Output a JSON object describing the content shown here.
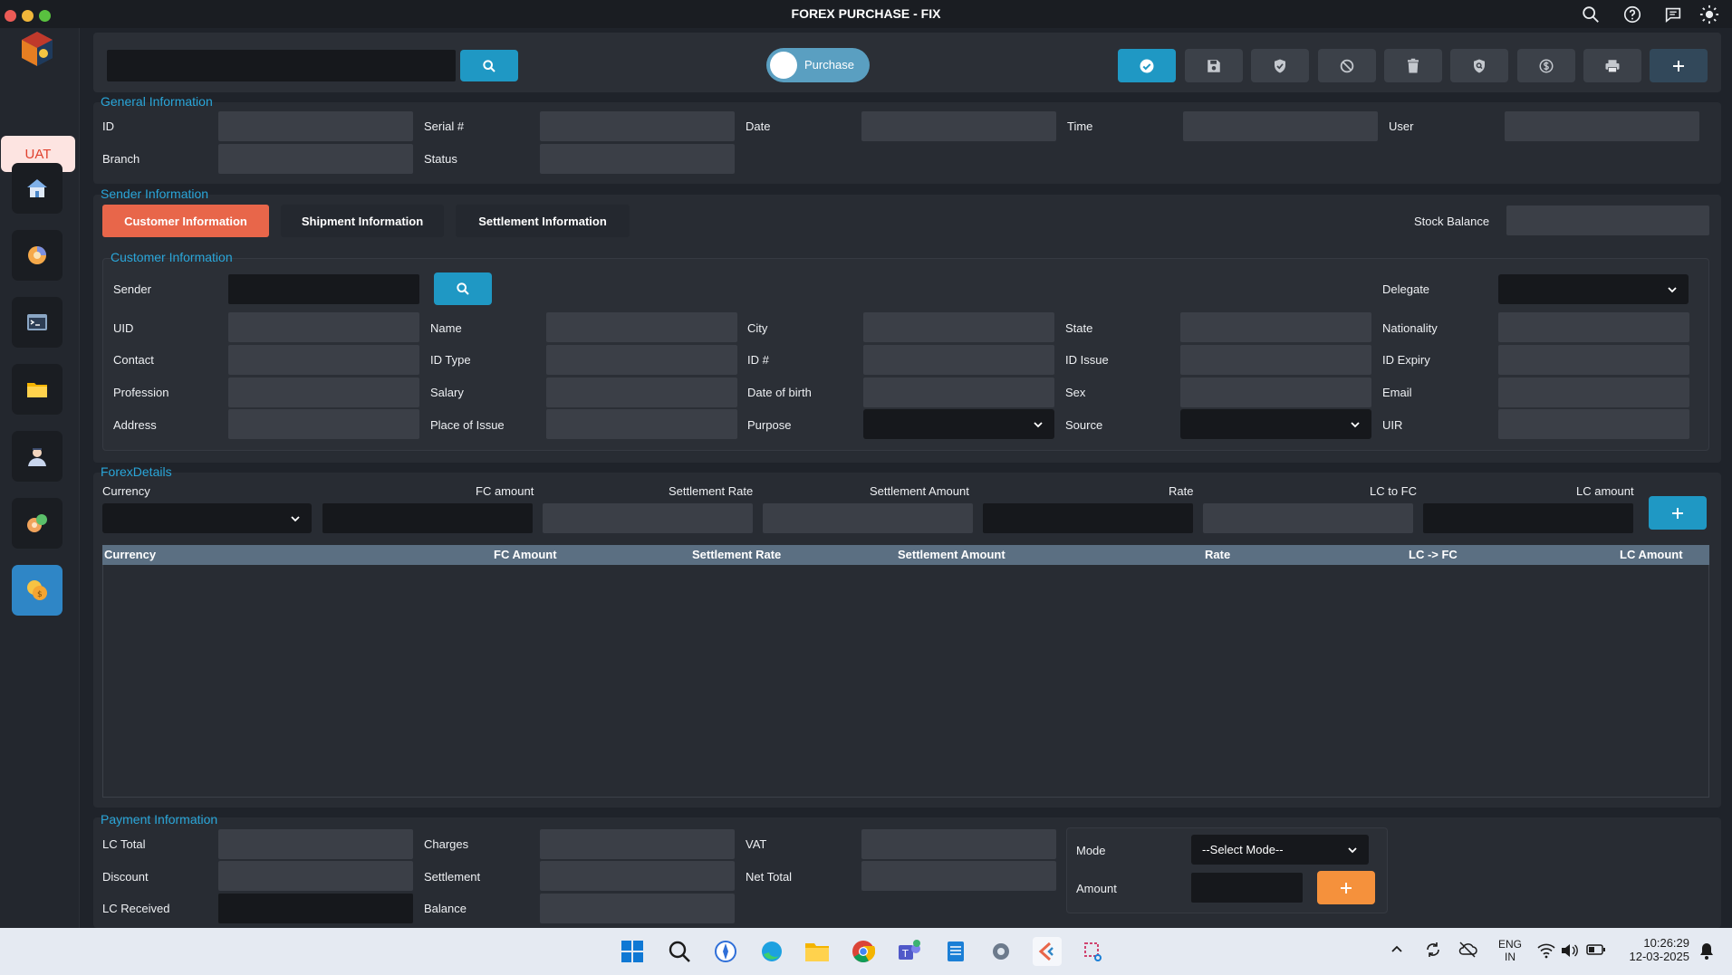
{
  "window": {
    "title": "FOREX PURCHASE - FIX"
  },
  "env_badge": "UAT",
  "toolbar": {
    "search_placeholder": "",
    "mode_toggle_label": "Purchase"
  },
  "general": {
    "title": "General Information",
    "id_label": "ID",
    "serial_label": "Serial #",
    "date_label": "Date",
    "time_label": "Time",
    "user_label": "User",
    "branch_label": "Branch",
    "status_label": "Status"
  },
  "sender": {
    "title": "Sender Information",
    "tabs": [
      "Customer Information",
      "Shipment Information",
      "Settlement Information"
    ],
    "stock_balance_label": "Stock Balance"
  },
  "customer": {
    "title": "Customer Information",
    "sender_label": "Sender",
    "delegate_label": "Delegate",
    "uid_label": "UID",
    "name_label": "Name",
    "city_label": "City",
    "state_label": "State",
    "nationality_label": "Nationality",
    "contact_label": "Contact",
    "id_type_label": "ID Type",
    "id_no_label": "ID #",
    "id_issue_label": "ID Issue",
    "id_expiry_label": "ID Expiry",
    "profession_label": "Profession",
    "salary_label": "Salary",
    "dob_label": "Date of birth",
    "sex_label": "Sex",
    "email_label": "Email",
    "address_label": "Address",
    "place_issue_label": "Place of Issue",
    "purpose_label": "Purpose",
    "source_label": "Source",
    "uir_label": "UIR"
  },
  "forex": {
    "title": "ForexDetails",
    "currency_label": "Currency",
    "fc_amount_label": "FC amount",
    "settlement_rate_label": "Settlement Rate",
    "settlement_amount_label": "Settlement Amount",
    "rate_label": "Rate",
    "lc_to_fc_label": "LC to FC",
    "lc_amount_label": "LC amount",
    "grid_columns": [
      "Currency",
      "FC Amount",
      "Settlement Rate",
      "Settlement Amount",
      "Rate",
      "LC -> FC",
      "LC Amount"
    ]
  },
  "payment": {
    "title": "Payment Information",
    "lc_total_label": "LC Total",
    "charges_label": "Charges",
    "vat_label": "VAT",
    "discount_label": "Discount",
    "settlement_label": "Settlement",
    "net_total_label": "Net Total",
    "lc_received_label": "LC Received",
    "balance_label": "Balance",
    "mode_label": "Mode",
    "mode_value": "--Select Mode--",
    "amount_label": "Amount"
  },
  "taskbar": {
    "lang_top": "ENG",
    "lang_bottom": "IN",
    "time": "10:26:29",
    "date": "12-03-2025"
  },
  "colors": {
    "accent_blue": "#1f98c4",
    "section_title": "#2aa6d9",
    "active_tab": "#e8664a",
    "add_orange": "#f5913c",
    "env_badge_bg": "#fde4e1",
    "env_badge_fg": "#e0422f"
  }
}
